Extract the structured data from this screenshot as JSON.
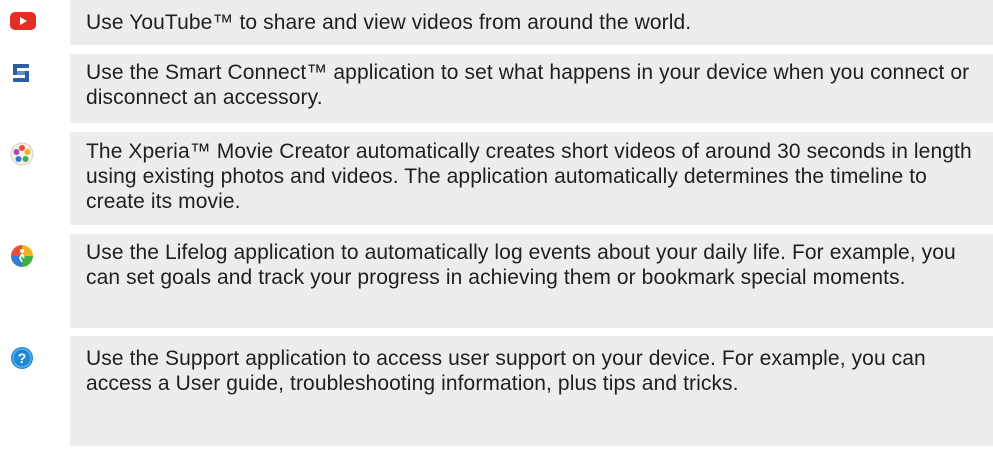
{
  "items": [
    {
      "icon": "youtube-icon",
      "text": "Use YouTube™ to share and view videos from around the world."
    },
    {
      "icon": "smart-connect-icon",
      "text": "Use the Smart Connect™ application to set what happens in your device when you connect or disconnect an accessory."
    },
    {
      "icon": "movie-creator-icon",
      "text": "The Xperia™ Movie Creator automatically creates short videos of around 30 seconds in length using existing photos and videos. The application automatically determines the timeline to create its movie."
    },
    {
      "icon": "lifelog-icon",
      "text": "Use the Lifelog application to automatically log events about your daily life. For example, you can set goals and track your progress in achieving them or bookmark special moments."
    },
    {
      "icon": "support-icon",
      "text": "Use the Support application to access user support on your device. For example, you can access a User guide, troubleshooting information, plus tips and tricks."
    }
  ],
  "colors": {
    "row_background": "#ededed",
    "youtube_red": "#e52d27",
    "smart_connect_blue": "#2a5ea8",
    "support_blue": "#1e88d2"
  }
}
